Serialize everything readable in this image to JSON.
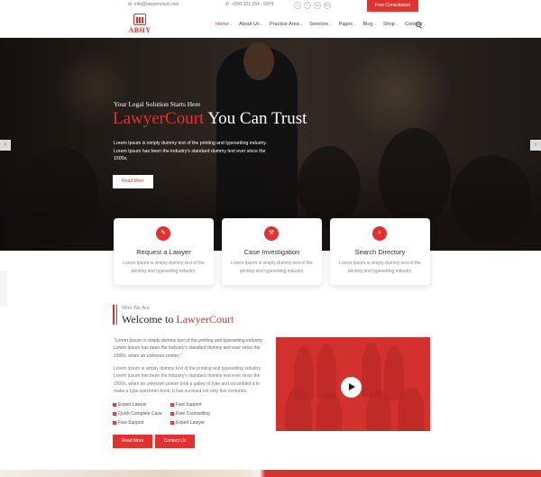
{
  "topbar": {
    "email": "info@lawyercourt.com",
    "phone": "+000 321 254 - 5874",
    "social": [
      "f",
      "t",
      "in",
      "G+"
    ],
    "consult_label": "Free Consultation"
  },
  "nav": {
    "logo_text": "ABHY",
    "items": [
      {
        "label": "Home",
        "dropdown": true
      },
      {
        "label": "About Us",
        "dropdown": true
      },
      {
        "label": "Practice Area",
        "dropdown": true
      },
      {
        "label": "Services",
        "dropdown": true
      },
      {
        "label": "Pages",
        "dropdown": true
      },
      {
        "label": "Blog",
        "dropdown": true
      },
      {
        "label": "Shop",
        "dropdown": true
      },
      {
        "label": "Contact",
        "dropdown": true
      }
    ],
    "active_item": "Home",
    "accent_color": "#e0322f"
  },
  "hero": {
    "subtitle": "Your Legal Solution Starts Here",
    "title_red": "LawyerCourt",
    "title_rest": " You Can Trust",
    "description": "Lorem Ipsum is simply dummy text of the printing and typesetting industry. Lorem Ipsum has been the industry's standard dummy text ever since the 1500s,",
    "button_label": "Read More",
    "prev_arrow": "‹",
    "next_arrow": "›"
  },
  "cards": [
    {
      "icon": "edit-icon",
      "glyph": "✎",
      "title": "Request a Lawyer",
      "text": "Lorem Ipsum is simply dummy text of the printing and typesetting industry."
    },
    {
      "icon": "gavel-icon",
      "glyph": "⚒",
      "title": "Case Investigation",
      "text": "Lorem Ipsum is simply dummy text of the printing and typesetting industry."
    },
    {
      "icon": "search-icon",
      "glyph": "⌕",
      "title": "Search Directory",
      "text": "Lorem Ipsum is simply dummy text of the printing and typesetting industry."
    }
  ],
  "about": {
    "small_title": "Who We Are",
    "title_dark": "Welcome to ",
    "title_red": "LawyerCourt",
    "quote": "\"Lorem Ipsum is simply dummy text of the printing and typesetting industry. Lorem Ipsum has been the industry's standard dummy text ever since the 1500s, when an unknown printer.\"",
    "paragraph": "Lorem Ipsum is simply dummy text of the printing and typesetting industry. Lorem Ipsum has been the industry's standard dummy text ever since the 1500s, when an unknown printer took a galley of type and scrambled it to make a type specimen book. It has survived not only five centuries.",
    "checks_left": [
      "Expert Lawyer",
      "Quick Complete Case",
      "Fast Support"
    ],
    "checks_right": [
      "Fast Support",
      "Free Counselling",
      "Expert Lawyer"
    ],
    "read_more_label": "Read More",
    "contact_label": "Contact Us"
  }
}
